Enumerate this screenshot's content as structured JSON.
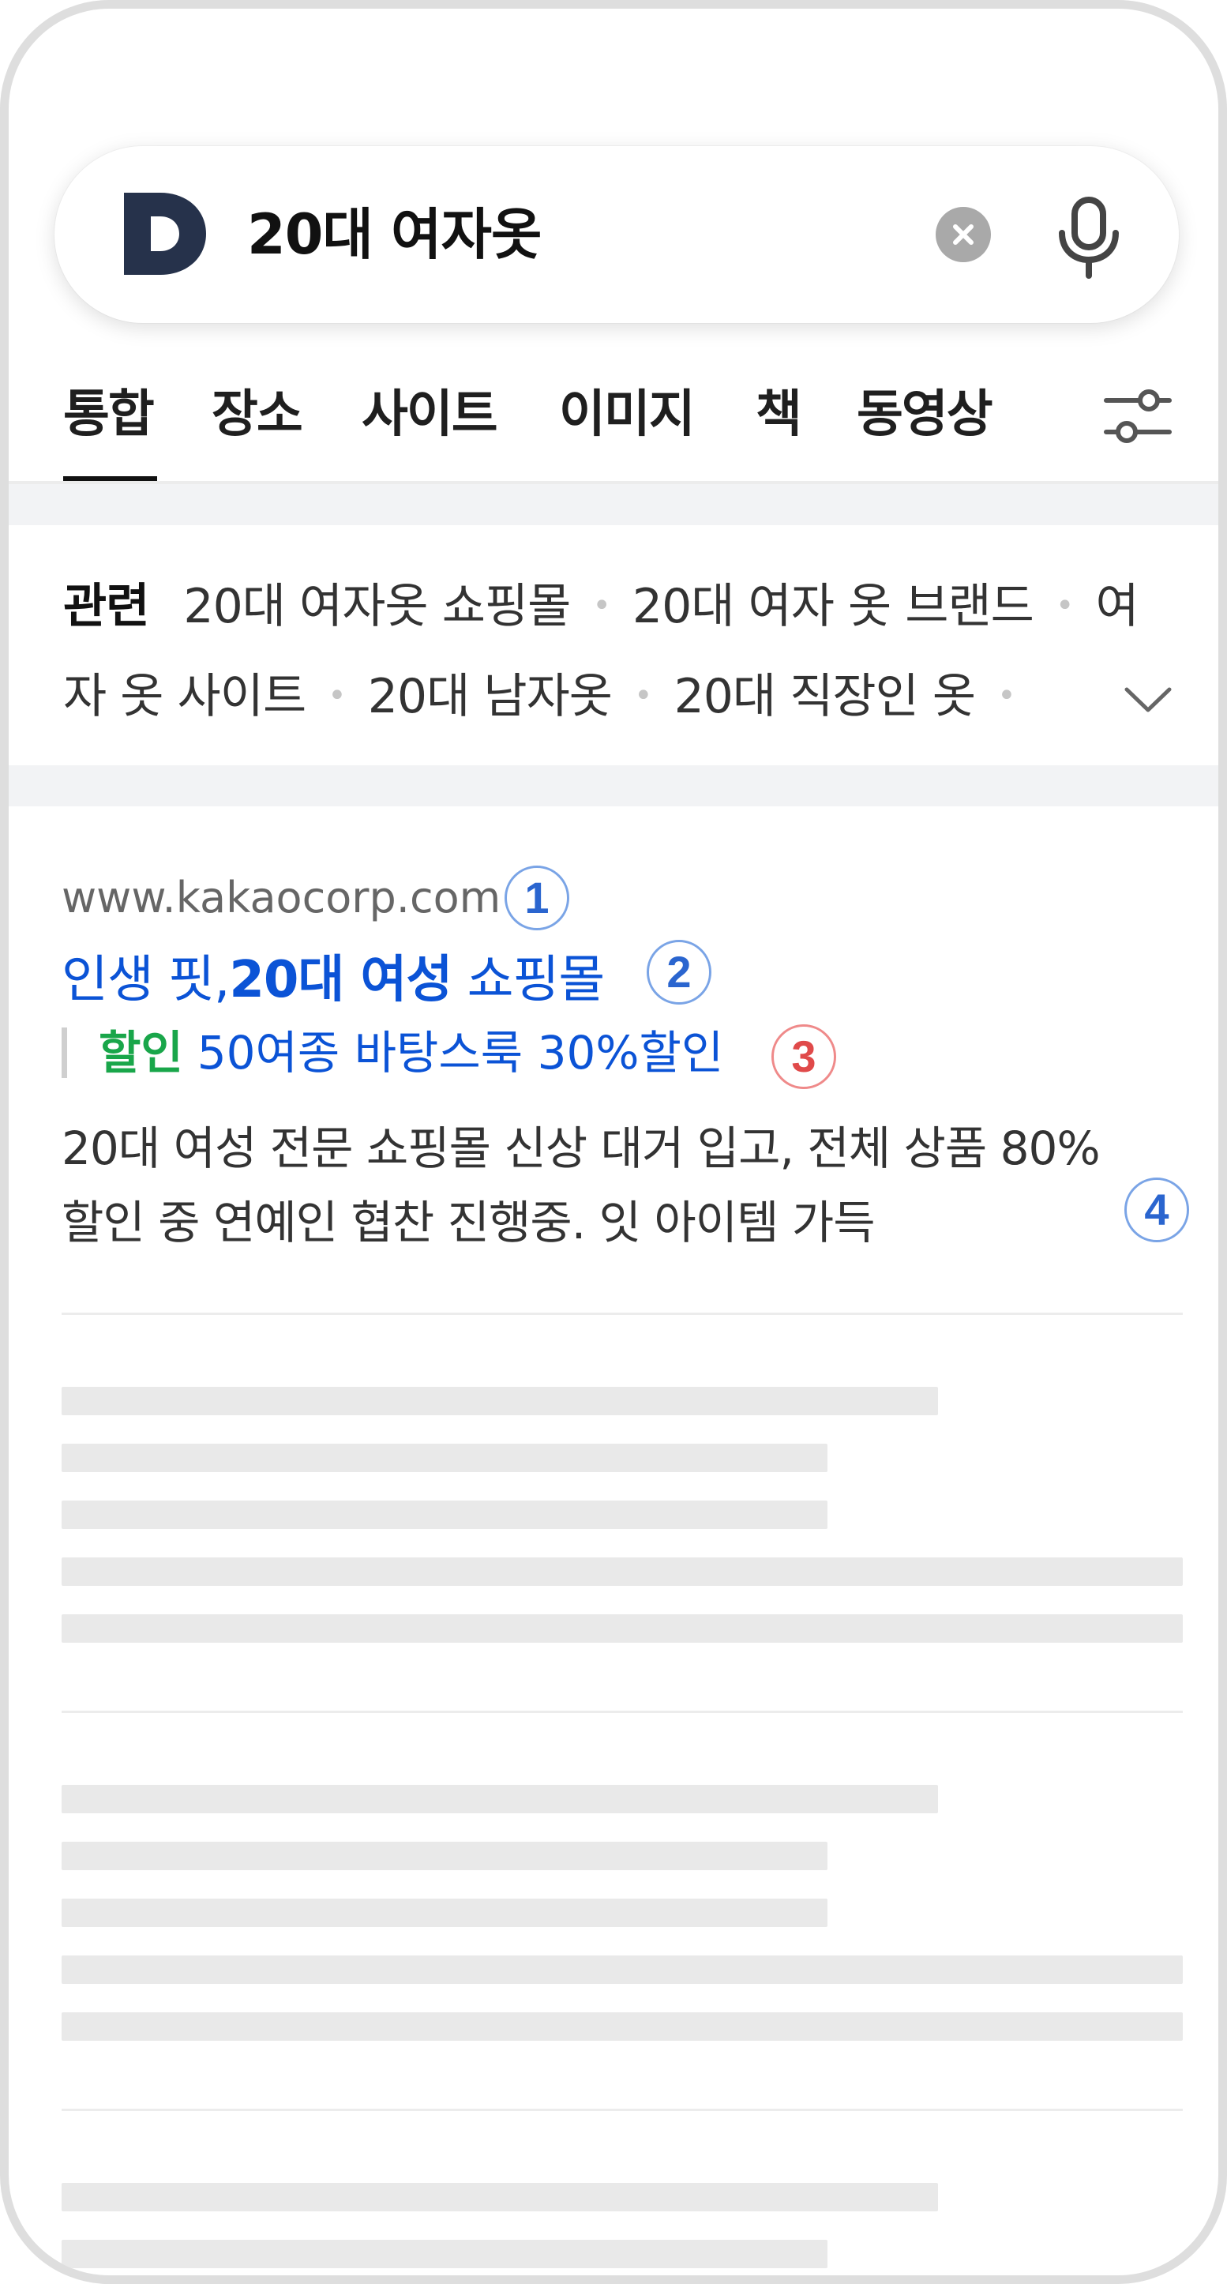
{
  "search": {
    "logo_letter": "D",
    "query": "20대 여자옷",
    "clear_icon": "clear-circle-icon",
    "mic_icon": "microphone-icon"
  },
  "tabs": [
    {
      "label": "통합",
      "active": true
    },
    {
      "label": "장소",
      "active": false
    },
    {
      "label": "사이트",
      "active": false
    },
    {
      "label": "이미지",
      "active": false
    },
    {
      "label": "책",
      "active": false
    },
    {
      "label": "동영상",
      "active": false
    }
  ],
  "filter_icon": "filter-sliders-icon",
  "related": {
    "title": "관련",
    "items": [
      "20대 여자옷 쇼핑몰",
      "20대 여자 옷 브랜드",
      "여자 옷 사이트",
      "20대 남자옷",
      "20대 직장인 옷"
    ],
    "line1_tail": "여",
    "line2_head": "자 옷 사이트",
    "expand_icon": "chevron-down-icon"
  },
  "ad": {
    "url": "www.kakaocorp.com",
    "title_pre": "인생 핏,",
    "title_bold": "20대 여성",
    "title_post": " 쇼핑몰",
    "promo_tag": "할인",
    "promo_text": "50여종 바탕스룩 30%할인",
    "desc_line1": "20대 여성 전문 쇼핑몰 신상 대거 입고, 전체 상품 80%",
    "desc_line2": "할인 중 연예인 협찬 진행중. 잇 아이템 가득",
    "markers": [
      "1",
      "2",
      "3",
      "4"
    ]
  },
  "colors": {
    "link_blue": "#0b53d6",
    "promo_green": "#19a64a",
    "marker_blue": "#2a65cf",
    "marker_red": "#e04a4a",
    "logo_navy": "#26324b"
  }
}
